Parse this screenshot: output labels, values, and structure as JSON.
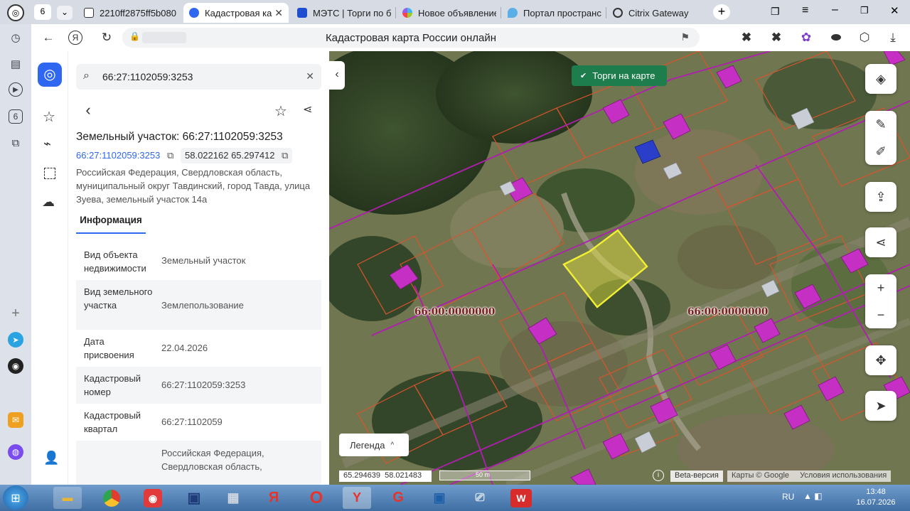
{
  "browser": {
    "tab_counter": "6",
    "tabs": [
      {
        "label": "2210ff2875ff5b080",
        "active": false
      },
      {
        "label": "Кадастровая ка",
        "active": true
      },
      {
        "label": "МЭТС | Торги по б",
        "active": false
      },
      {
        "label": "Новое объявление",
        "active": false
      },
      {
        "label": "Портал пространс",
        "active": false
      },
      {
        "label": "Citrix Gateway",
        "active": false
      }
    ],
    "page_title": "Кадастровая карта России онлайн"
  },
  "sidebar_badge": "6",
  "panel": {
    "search_value": "66:27:1102059:3253",
    "title": "Земельный участок: 66:27:1102059:3253",
    "cadastral_link": "66:27:1102059:3253",
    "coords": "58.022162 65.297412",
    "address": "Российская Федерация, Свердловская область, муниципальный округ Тавдинский, город Тавда, улица Зуева, земельный участок 14а",
    "tab_info": "Информация",
    "rows": [
      {
        "k": "Вид объекта недвижимости",
        "v": "Земельный участок"
      },
      {
        "k": "Вид земельного участка",
        "v": "Землепользование"
      },
      {
        "k": "Дата присвоения",
        "v": "22.04.2026"
      },
      {
        "k": "Кадастровый номер",
        "v": "66:27:1102059:3253"
      },
      {
        "k": "Кадастровый квартал",
        "v": "66:27:1102059"
      },
      {
        "k": "",
        "v": "Российская Федерация, Свердловская область,"
      }
    ]
  },
  "map": {
    "torgi_button": "Торги на карте",
    "quarter_label_left": "66:00:0000000",
    "quarter_label_right": "66:00:0000000",
    "legend_button": "Легенда",
    "cursor_coords": "65.294639  58.021483",
    "scale_label": "50 m",
    "beta": "Beta-версия",
    "copyright": "Карты © Google",
    "terms": "Условия использования"
  },
  "taskbar": {
    "lang": "RU",
    "time": "13:48",
    "date": "16.07.2026"
  },
  "colors": {
    "accent": "#2f67f0",
    "parcel_fill": "#e6e43c",
    "boundary_purple": "#b01eb0",
    "boundary_orange": "#d9552c",
    "torgi_green": "#1e7d4c"
  }
}
